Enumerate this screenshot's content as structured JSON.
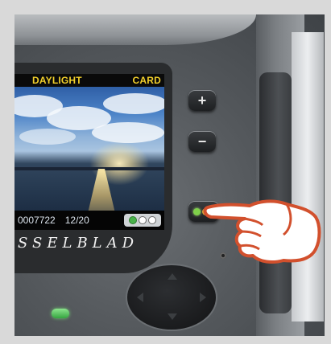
{
  "camera": {
    "display": {
      "white_balance": "DAYLIGHT",
      "storage": "CARD",
      "image_number": "0007722",
      "frame_counter": "12/20"
    },
    "brand_text": "SSELBLAD"
  },
  "controls": {
    "plus_label": "+",
    "minus_label": "−"
  },
  "colors": {
    "hud_text": "#f2d02b",
    "led_green": "#7fd04a",
    "hand_outline": "#d2502d"
  }
}
